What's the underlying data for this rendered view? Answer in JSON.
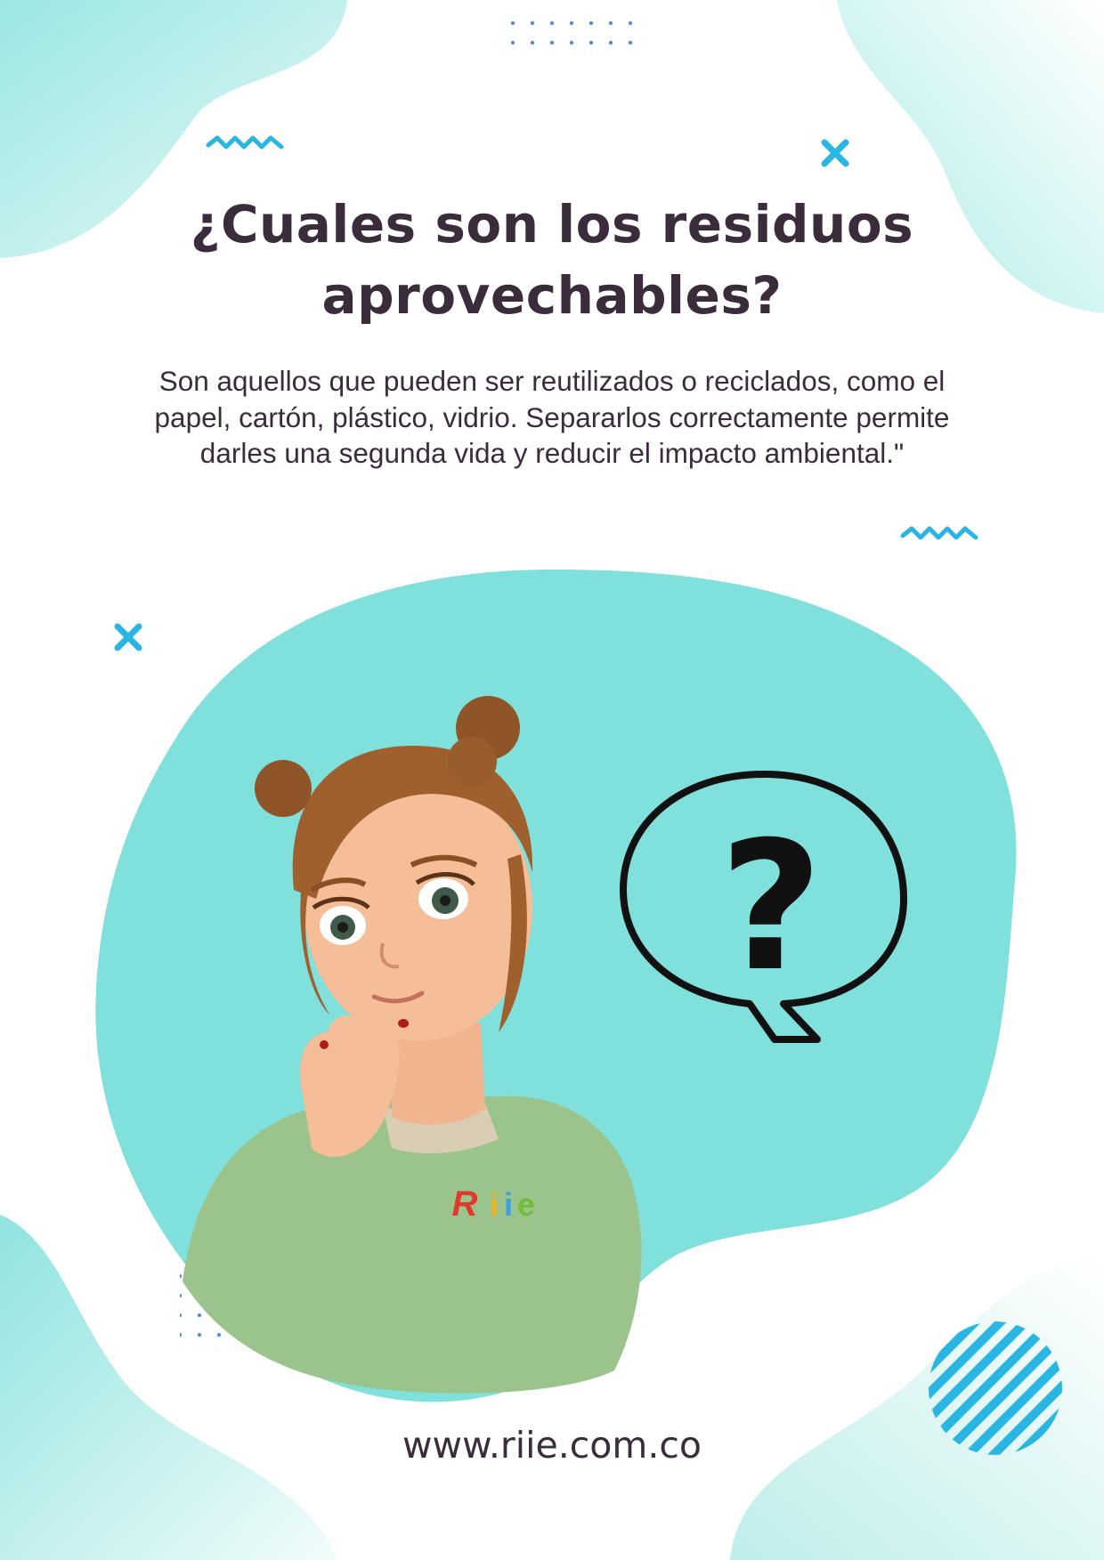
{
  "poster": {
    "title": "¿Cuales son los residuos aprovechables?",
    "body": "Son aquellos que pueden ser reutilizados o reciclados, como el papel, cartón, plástico, vidrio. Separarlos correctamente permite darles una segunda vida y reducir el impacto ambiental.\"",
    "website": "www.riie.com.co"
  },
  "illustration": {
    "character": "girl-thinking",
    "bubble_symbol": "?",
    "shirt_logo": "Riie"
  },
  "colors": {
    "text": "#3b2c3c",
    "aqua": "#7fe0dc",
    "blob_light": "#d6f5f3",
    "accent_blue": "#29b6e3",
    "dots": "#5b8ed6",
    "shirt": "#9bc48d"
  }
}
